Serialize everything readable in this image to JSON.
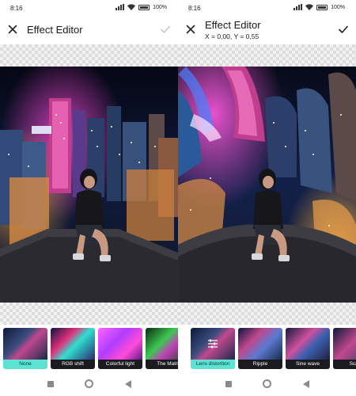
{
  "status": {
    "time": "8:16",
    "battery_pct": "100"
  },
  "editor": {
    "title": "Effect Editor",
    "coords": "X = 0,00, Y = 0,55"
  },
  "effects_left": [
    {
      "label": "None",
      "selected": true
    },
    {
      "label": "RGB shift",
      "selected": false
    },
    {
      "label": "Colorful light",
      "selected": false
    },
    {
      "label": "The Matri",
      "selected": false
    }
  ],
  "effects_right": [
    {
      "label": "Lens distortion",
      "selected": true
    },
    {
      "label": "Ripple",
      "selected": false
    },
    {
      "label": "Sine wave",
      "selected": false
    },
    {
      "label": "Scan",
      "selected": false
    }
  ],
  "icons": {
    "close": "close-icon",
    "confirm": "check-icon",
    "adjust": "sliders-icon",
    "nav_recent": "square-icon",
    "nav_home": "circle-icon",
    "nav_back": "back-triangle-icon"
  },
  "colors": {
    "selected_label": "#5ee3d2",
    "label_bg": "#1b1b1f",
    "confirm_disabled": "#c8c8c8",
    "confirm_enabled": "#222222"
  }
}
